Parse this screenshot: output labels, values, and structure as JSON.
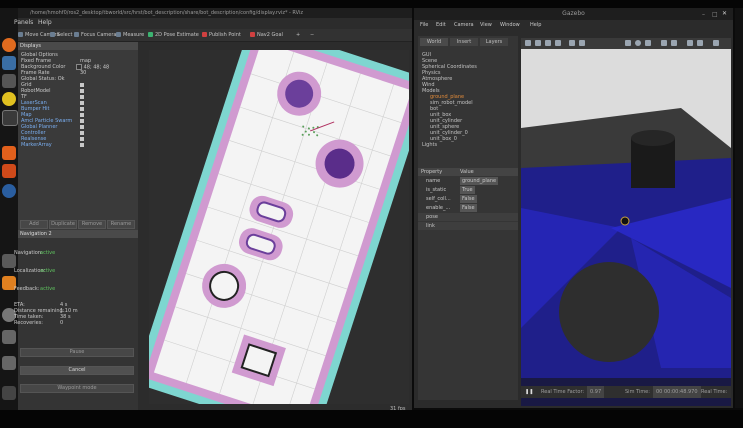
{
  "rviz": {
    "title": "/home/hmohf0/ros2_desktop/tbworld/src/hrst/bot_description/share/bot_description/config/display.rviz* - RViz",
    "menu": [
      "Panels",
      "Help"
    ],
    "toolbar": [
      "Move Camera",
      "Select",
      "Focus Camera",
      "Measure",
      "2D Pose Estimate",
      "Publish Point",
      "Nav2 Goal"
    ],
    "displays_header": "Displays",
    "displays": [
      {
        "name": "Global Options"
      },
      {
        "name": "Fixed Frame",
        "value": "map"
      },
      {
        "name": "Background Color",
        "value": "48; 48; 48"
      },
      {
        "name": "Frame Rate",
        "value": "30"
      },
      {
        "name": "Global Status: Ok"
      },
      {
        "name": "Grid",
        "checked": true
      },
      {
        "name": "RobotModel",
        "checked": true
      },
      {
        "name": "TF",
        "checked": true
      },
      {
        "name": "LaserScan",
        "checked": true,
        "blue": true
      },
      {
        "name": "Bumper Hit",
        "checked": true,
        "blue": true
      },
      {
        "name": "Map",
        "checked": true,
        "blue": true
      },
      {
        "name": "Amcl Particle Swarm",
        "checked": true,
        "blue": true
      },
      {
        "name": "Global Planner",
        "checked": true,
        "blue": true
      },
      {
        "name": "Controller",
        "checked": true,
        "blue": true
      },
      {
        "name": "Realsense",
        "checked": true,
        "blue": true
      },
      {
        "name": "MarkerArray",
        "checked": true,
        "blue": true
      }
    ],
    "display_buttons": [
      "Add",
      "Duplicate",
      "Remove",
      "Rename"
    ],
    "nav_header": "Navigation 2",
    "navigation": {
      "navigation_label": "Navigation:",
      "navigation_status": "active",
      "localization_label": "Localization:",
      "localization_status": "active",
      "feedback_label": "Feedback:",
      "feedback_status": "active",
      "rows": [
        {
          "label": "ETA:",
          "value": "4 s"
        },
        {
          "label": "Distance remaining:",
          "value": "1.10 m"
        },
        {
          "label": "Time taken:",
          "value": "38 s"
        },
        {
          "label": "Recoveries:",
          "value": "0"
        }
      ],
      "pause": "Pause",
      "cancel": "Cancel",
      "waypoint": "Waypoint mode"
    },
    "fps": "31 fps"
  },
  "gazebo": {
    "title": "Gazebo",
    "menu": [
      "File",
      "Edit",
      "Camera",
      "View",
      "Window",
      "Help"
    ],
    "tabs": [
      "World",
      "Insert",
      "Layers"
    ],
    "tree": [
      "GUI",
      "Scene",
      "Spherical Coordinates",
      "Physics",
      "Atmosphere",
      "Wind",
      "Models",
      "ground_plane",
      "sim_robot_model",
      "bot",
      "unit_box",
      "unit_cylinder",
      "unit_sphere",
      "unit_cylinder_0",
      "unit_box_0",
      "Lights"
    ],
    "props_header": [
      "Property",
      "Value"
    ],
    "props": [
      {
        "name": "name",
        "value": "ground_plane"
      },
      {
        "name": "is_static",
        "value": "True"
      },
      {
        "name": "self_coll...",
        "value": "False"
      },
      {
        "name": "enable_...",
        "value": "False"
      },
      {
        "name": "pose",
        "value": ""
      },
      {
        "name": "link",
        "value": ""
      }
    ],
    "bottom": {
      "rtf_label": "Real Time Factor:",
      "rtf": "0.97",
      "sim_label": "Sim Time:",
      "sim": "00 00:00:48.970",
      "real_label": "Real Time:"
    }
  },
  "colors": {
    "rviz_bg": "#303030",
    "laser": "#3f3fff",
    "costmap_pink": "#d09ad0",
    "costmap_cyan": "#7ed6d0"
  }
}
